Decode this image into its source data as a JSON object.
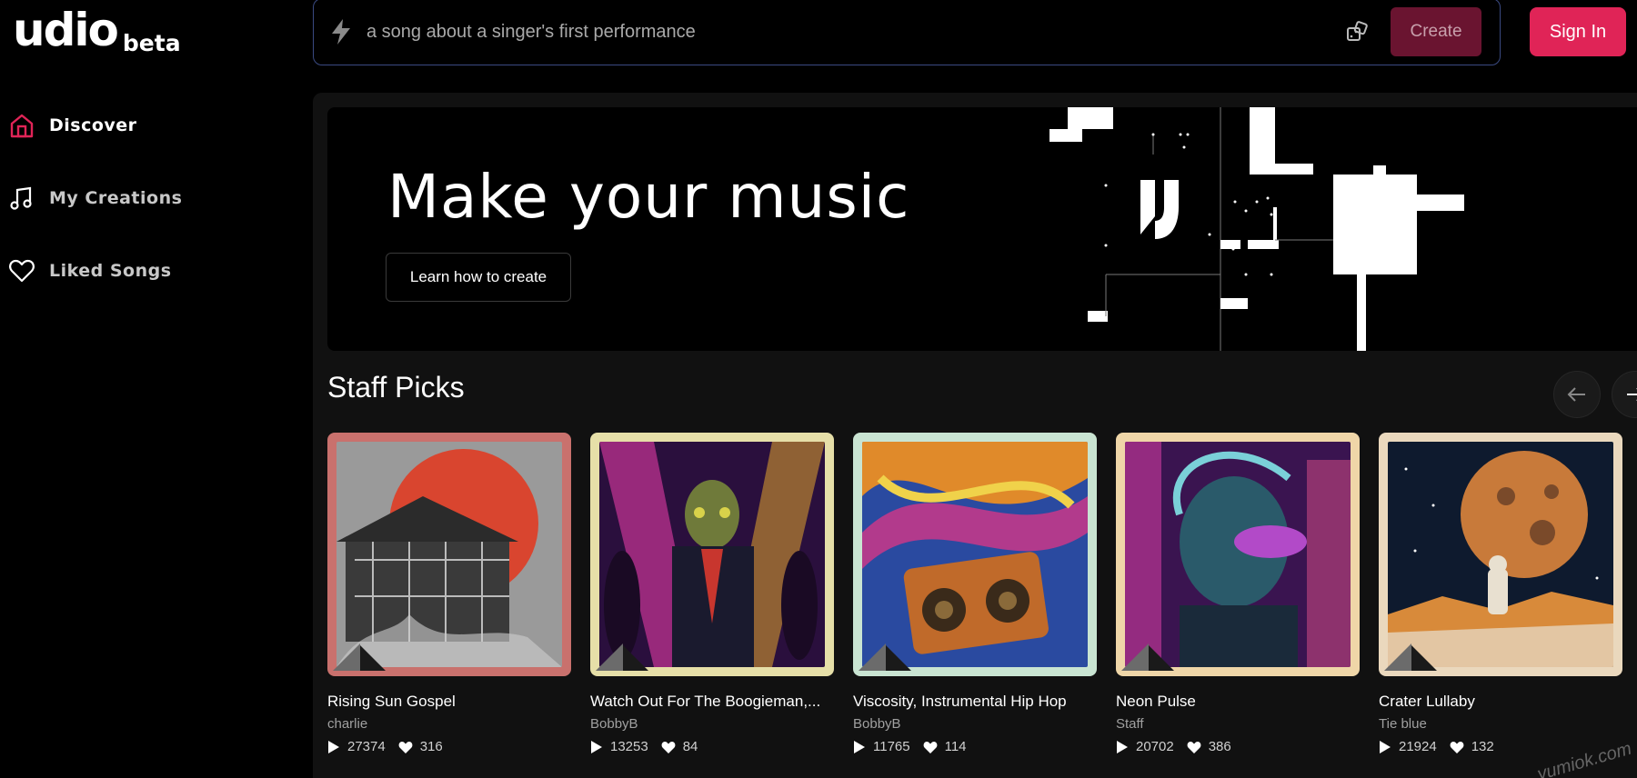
{
  "brand": {
    "name": "udio",
    "tag": "beta"
  },
  "sidebar": {
    "items": [
      {
        "label": "Discover",
        "icon": "home-icon",
        "active": true
      },
      {
        "label": "My Creations",
        "icon": "music-note-icon",
        "active": false
      },
      {
        "label": "Liked Songs",
        "icon": "heart-icon",
        "active": false
      }
    ]
  },
  "prompt": {
    "placeholder": "a song about a singer's first performance",
    "create_label": "Create"
  },
  "header": {
    "signin_label": "Sign In"
  },
  "hero": {
    "title": "Make your music",
    "cta_label": "Learn how to create"
  },
  "staff_picks": {
    "title": "Staff Picks",
    "cards": [
      {
        "title": "Rising Sun Gospel",
        "author": "charlie",
        "plays": "27374",
        "likes": "316",
        "frame_color": "#c9716d"
      },
      {
        "title": "Watch Out For The Boogieman,...",
        "author": "BobbyB",
        "plays": "13253",
        "likes": "84",
        "frame_color": "#e6dfa8"
      },
      {
        "title": "Viscosity, Instrumental Hip Hop",
        "author": "BobbyB",
        "plays": "11765",
        "likes": "114",
        "frame_color": "#c9e4d2"
      },
      {
        "title": "Neon Pulse",
        "author": "Staff",
        "plays": "20702",
        "likes": "386",
        "frame_color": "#efd6a8"
      },
      {
        "title": "Crater Lullaby",
        "author": "Tie blue",
        "plays": "21924",
        "likes": "132",
        "frame_color": "#ead8bd"
      }
    ]
  },
  "colors": {
    "accent": "#e02457",
    "create_bg": "#6a1430",
    "panel_bg": "#111111"
  },
  "watermark": "yumiok.com"
}
